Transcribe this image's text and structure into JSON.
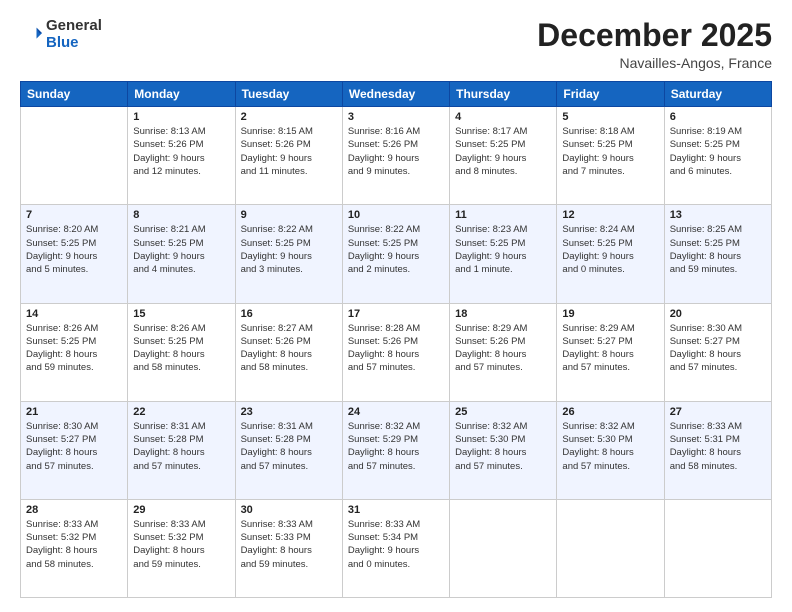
{
  "header": {
    "logo_general": "General",
    "logo_blue": "Blue",
    "month_title": "December 2025",
    "location": "Navailles-Angos, France"
  },
  "days_of_week": [
    "Sunday",
    "Monday",
    "Tuesday",
    "Wednesday",
    "Thursday",
    "Friday",
    "Saturday"
  ],
  "weeks": [
    [
      {
        "day": "",
        "info": ""
      },
      {
        "day": "1",
        "info": "Sunrise: 8:13 AM\nSunset: 5:26 PM\nDaylight: 9 hours\nand 12 minutes."
      },
      {
        "day": "2",
        "info": "Sunrise: 8:15 AM\nSunset: 5:26 PM\nDaylight: 9 hours\nand 11 minutes."
      },
      {
        "day": "3",
        "info": "Sunrise: 8:16 AM\nSunset: 5:26 PM\nDaylight: 9 hours\nand 9 minutes."
      },
      {
        "day": "4",
        "info": "Sunrise: 8:17 AM\nSunset: 5:25 PM\nDaylight: 9 hours\nand 8 minutes."
      },
      {
        "day": "5",
        "info": "Sunrise: 8:18 AM\nSunset: 5:25 PM\nDaylight: 9 hours\nand 7 minutes."
      },
      {
        "day": "6",
        "info": "Sunrise: 8:19 AM\nSunset: 5:25 PM\nDaylight: 9 hours\nand 6 minutes."
      }
    ],
    [
      {
        "day": "7",
        "info": "Sunrise: 8:20 AM\nSunset: 5:25 PM\nDaylight: 9 hours\nand 5 minutes."
      },
      {
        "day": "8",
        "info": "Sunrise: 8:21 AM\nSunset: 5:25 PM\nDaylight: 9 hours\nand 4 minutes."
      },
      {
        "day": "9",
        "info": "Sunrise: 8:22 AM\nSunset: 5:25 PM\nDaylight: 9 hours\nand 3 minutes."
      },
      {
        "day": "10",
        "info": "Sunrise: 8:22 AM\nSunset: 5:25 PM\nDaylight: 9 hours\nand 2 minutes."
      },
      {
        "day": "11",
        "info": "Sunrise: 8:23 AM\nSunset: 5:25 PM\nDaylight: 9 hours\nand 1 minute."
      },
      {
        "day": "12",
        "info": "Sunrise: 8:24 AM\nSunset: 5:25 PM\nDaylight: 9 hours\nand 0 minutes."
      },
      {
        "day": "13",
        "info": "Sunrise: 8:25 AM\nSunset: 5:25 PM\nDaylight: 8 hours\nand 59 minutes."
      }
    ],
    [
      {
        "day": "14",
        "info": "Sunrise: 8:26 AM\nSunset: 5:25 PM\nDaylight: 8 hours\nand 59 minutes."
      },
      {
        "day": "15",
        "info": "Sunrise: 8:26 AM\nSunset: 5:25 PM\nDaylight: 8 hours\nand 58 minutes."
      },
      {
        "day": "16",
        "info": "Sunrise: 8:27 AM\nSunset: 5:26 PM\nDaylight: 8 hours\nand 58 minutes."
      },
      {
        "day": "17",
        "info": "Sunrise: 8:28 AM\nSunset: 5:26 PM\nDaylight: 8 hours\nand 57 minutes."
      },
      {
        "day": "18",
        "info": "Sunrise: 8:29 AM\nSunset: 5:26 PM\nDaylight: 8 hours\nand 57 minutes."
      },
      {
        "day": "19",
        "info": "Sunrise: 8:29 AM\nSunset: 5:27 PM\nDaylight: 8 hours\nand 57 minutes."
      },
      {
        "day": "20",
        "info": "Sunrise: 8:30 AM\nSunset: 5:27 PM\nDaylight: 8 hours\nand 57 minutes."
      }
    ],
    [
      {
        "day": "21",
        "info": "Sunrise: 8:30 AM\nSunset: 5:27 PM\nDaylight: 8 hours\nand 57 minutes."
      },
      {
        "day": "22",
        "info": "Sunrise: 8:31 AM\nSunset: 5:28 PM\nDaylight: 8 hours\nand 57 minutes."
      },
      {
        "day": "23",
        "info": "Sunrise: 8:31 AM\nSunset: 5:28 PM\nDaylight: 8 hours\nand 57 minutes."
      },
      {
        "day": "24",
        "info": "Sunrise: 8:32 AM\nSunset: 5:29 PM\nDaylight: 8 hours\nand 57 minutes."
      },
      {
        "day": "25",
        "info": "Sunrise: 8:32 AM\nSunset: 5:30 PM\nDaylight: 8 hours\nand 57 minutes."
      },
      {
        "day": "26",
        "info": "Sunrise: 8:32 AM\nSunset: 5:30 PM\nDaylight: 8 hours\nand 57 minutes."
      },
      {
        "day": "27",
        "info": "Sunrise: 8:33 AM\nSunset: 5:31 PM\nDaylight: 8 hours\nand 58 minutes."
      }
    ],
    [
      {
        "day": "28",
        "info": "Sunrise: 8:33 AM\nSunset: 5:32 PM\nDaylight: 8 hours\nand 58 minutes."
      },
      {
        "day": "29",
        "info": "Sunrise: 8:33 AM\nSunset: 5:32 PM\nDaylight: 8 hours\nand 59 minutes."
      },
      {
        "day": "30",
        "info": "Sunrise: 8:33 AM\nSunset: 5:33 PM\nDaylight: 8 hours\nand 59 minutes."
      },
      {
        "day": "31",
        "info": "Sunrise: 8:33 AM\nSunset: 5:34 PM\nDaylight: 9 hours\nand 0 minutes."
      },
      {
        "day": "",
        "info": ""
      },
      {
        "day": "",
        "info": ""
      },
      {
        "day": "",
        "info": ""
      }
    ]
  ]
}
